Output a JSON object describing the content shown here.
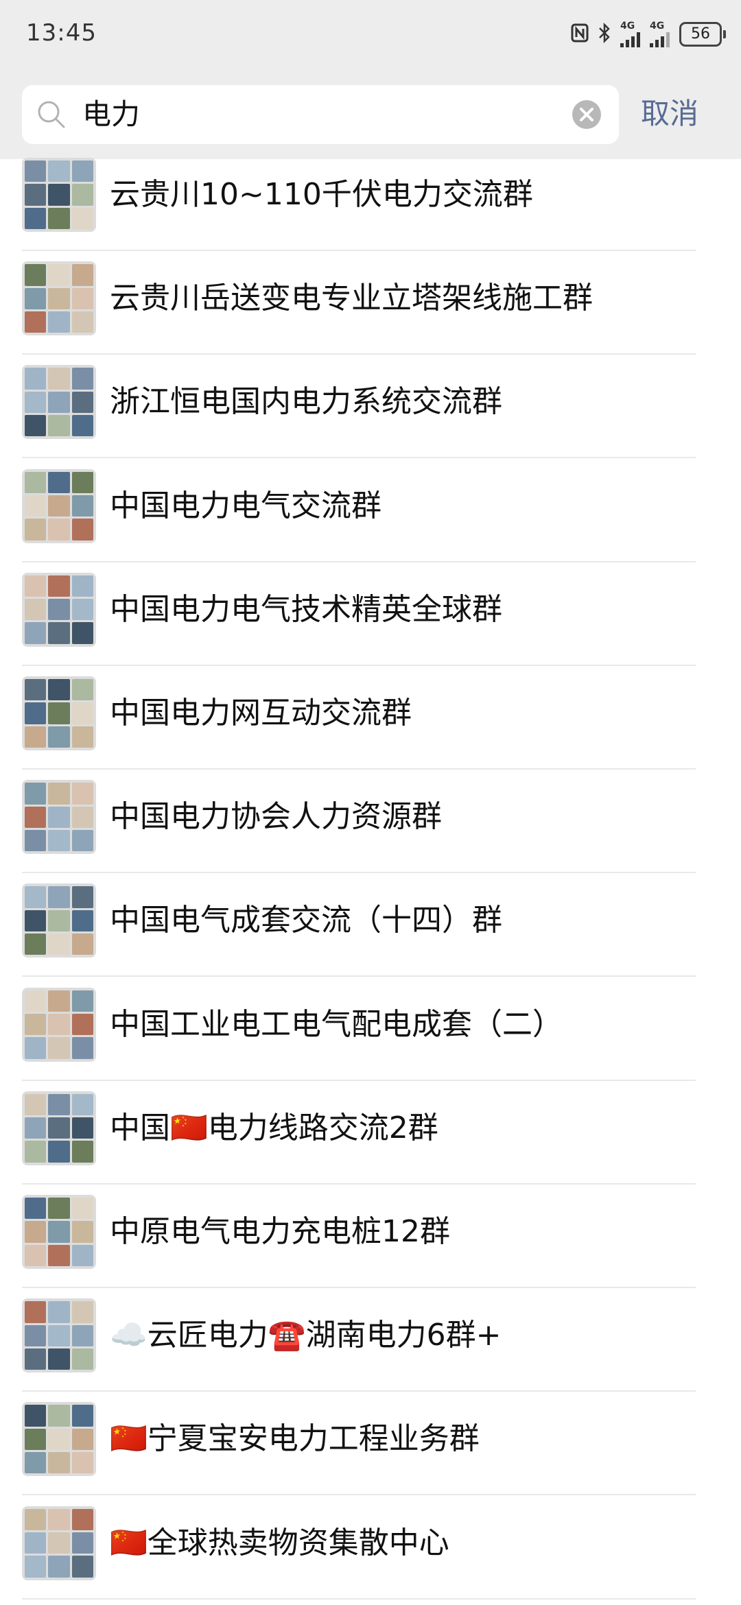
{
  "status_bar": {
    "time": "13:45",
    "icons": [
      "nfc-icon",
      "bluetooth-icon",
      "signal-4g-icon",
      "signal-4g-icon"
    ],
    "sim1_label": "4G",
    "sim2_label": "4G",
    "battery": "56"
  },
  "search": {
    "query": "电力",
    "cancel_label": "取消"
  },
  "results": [
    {
      "name": "云贵川10~110千伏电力交流群"
    },
    {
      "name": "云贵川岳送变电专业立塔架线施工群"
    },
    {
      "name": "浙江恒电国内电力系统交流群"
    },
    {
      "name": "中国电力电气交流群"
    },
    {
      "name": "中国电力电气技术精英全球群"
    },
    {
      "name": "中国电力网互动交流群"
    },
    {
      "name": "中国电力协会人力资源群"
    },
    {
      "name": "中国电气成套交流（十四）群"
    },
    {
      "name": "中国工业电工电气配电成套（二）"
    },
    {
      "name": "中国🇨🇳电力线路交流2群"
    },
    {
      "name": "中原电气电力充电桩12群"
    },
    {
      "name": "☁️云匠电力☎️湖南电力6群+"
    },
    {
      "name": "🇨🇳宁夏宝安电力工程业务群"
    },
    {
      "name": "🇨🇳全球热卖物资集散中心"
    }
  ],
  "colors": {
    "header_bg": "#ededed",
    "link": "#576b95"
  }
}
